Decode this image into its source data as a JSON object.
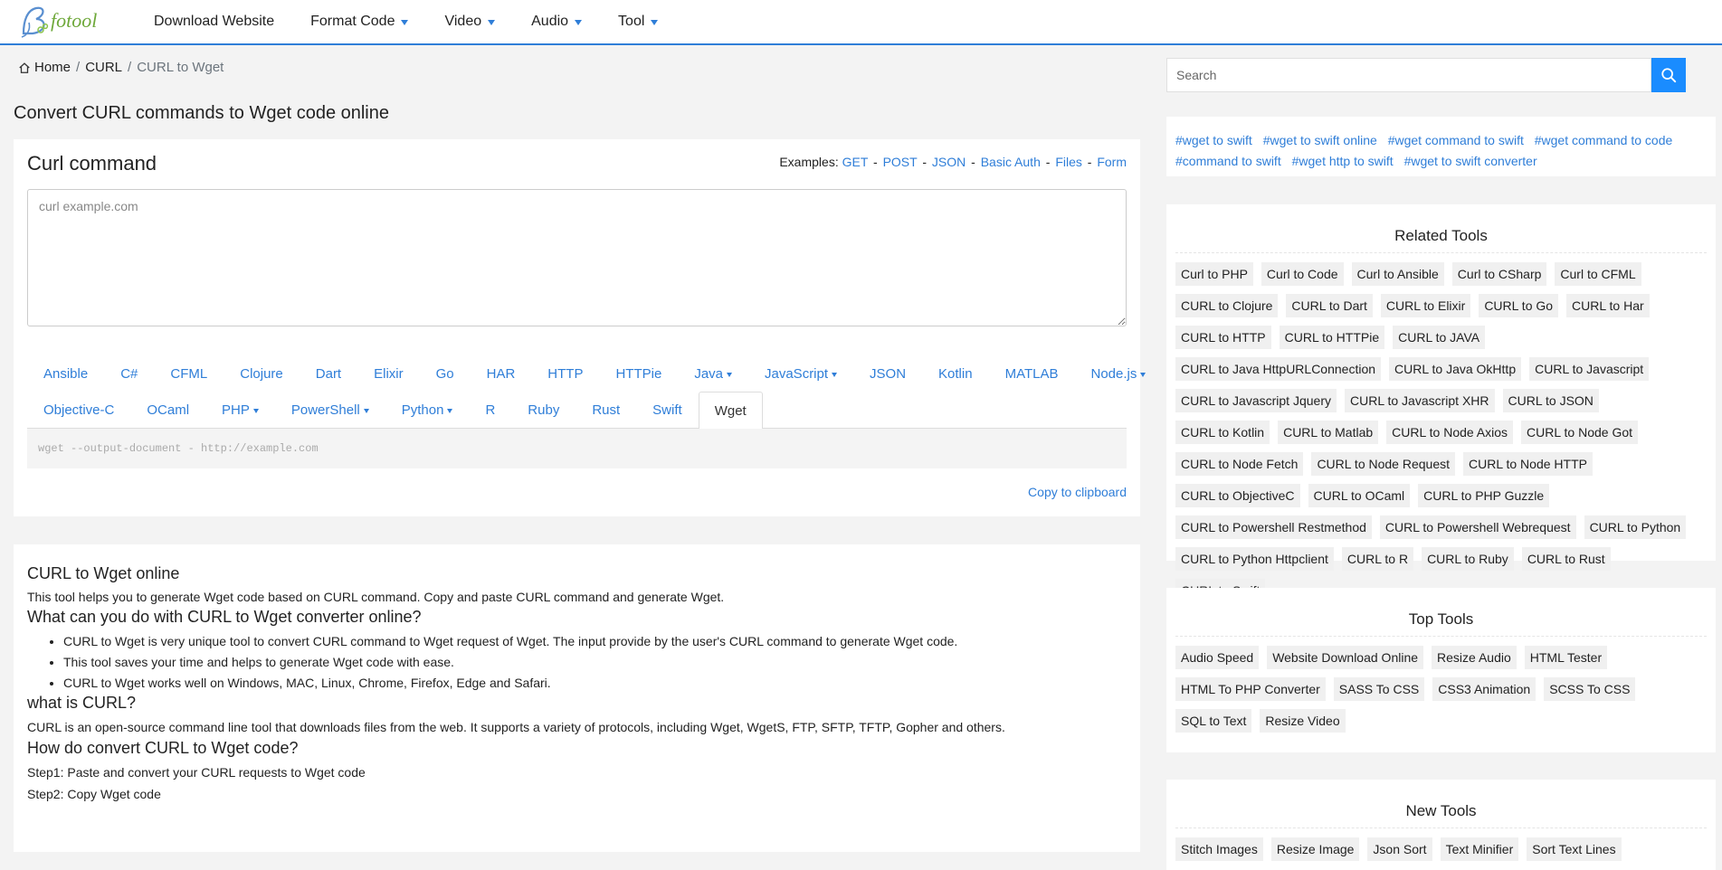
{
  "nav": {
    "logo_text": "fotool",
    "items": [
      {
        "label": "Download Website",
        "dropdown": false
      },
      {
        "label": "Format Code",
        "dropdown": true
      },
      {
        "label": "Video",
        "dropdown": true
      },
      {
        "label": "Audio",
        "dropdown": true
      },
      {
        "label": "Tool",
        "dropdown": true
      }
    ]
  },
  "breadcrumb": {
    "home": "Home",
    "sep1": "/",
    "curl": "CURL",
    "sep2": "/",
    "current": "CURL to Wget"
  },
  "page_title": "Convert CURL commands to Wget code online",
  "tool": {
    "title": "Curl command",
    "examples_label": "Examples:",
    "examples": [
      "GET",
      "POST",
      "JSON",
      "Basic Auth",
      "Files",
      "Form"
    ],
    "input_placeholder": "curl example.com",
    "tabs_row1": [
      {
        "label": "Ansible",
        "dropdown": false
      },
      {
        "label": "C#",
        "dropdown": false
      },
      {
        "label": "CFML",
        "dropdown": false
      },
      {
        "label": "Clojure",
        "dropdown": false
      },
      {
        "label": "Dart",
        "dropdown": false
      },
      {
        "label": "Elixir",
        "dropdown": false
      },
      {
        "label": "Go",
        "dropdown": false
      },
      {
        "label": "HAR",
        "dropdown": false
      },
      {
        "label": "HTTP",
        "dropdown": false
      },
      {
        "label": "HTTPie",
        "dropdown": false
      },
      {
        "label": "Java",
        "dropdown": true
      },
      {
        "label": "JavaScript",
        "dropdown": true
      },
      {
        "label": "JSON",
        "dropdown": false
      },
      {
        "label": "Kotlin",
        "dropdown": false
      },
      {
        "label": "MATLAB",
        "dropdown": false
      },
      {
        "label": "Node.js",
        "dropdown": true
      }
    ],
    "tabs_row2": [
      {
        "label": "Objective-C",
        "dropdown": false
      },
      {
        "label": "OCaml",
        "dropdown": false
      },
      {
        "label": "PHP",
        "dropdown": true
      },
      {
        "label": "PowerShell",
        "dropdown": true
      },
      {
        "label": "Python",
        "dropdown": true
      },
      {
        "label": "R",
        "dropdown": false
      },
      {
        "label": "Ruby",
        "dropdown": false
      },
      {
        "label": "Rust",
        "dropdown": false
      },
      {
        "label": "Swift",
        "dropdown": false
      },
      {
        "label": "Wget",
        "dropdown": false,
        "active": true
      }
    ],
    "output": "wget --output-document - http://example.com",
    "copy_label": "Copy to clipboard"
  },
  "info": {
    "h1": "CURL to Wget online",
    "p1": "This tool helps you to generate Wget code based on CURL command. Copy and paste CURL command and generate Wget.",
    "h2": "What can you do with CURL to Wget converter online?",
    "bullets": [
      "CURL to Wget is very unique tool to convert CURL command to Wget request of Wget. The input provide by the user's CURL command to generate Wget code.",
      "This tool saves your time and helps to generate Wget code with ease.",
      "CURL to Wget works well on Windows, MAC, Linux, Chrome, Firefox, Edge and Safari."
    ],
    "h3": "what is CURL?",
    "p2": "CURL is an open-source command line tool that downloads files from the web. It supports a variety of protocols, including Wget, WgetS, FTP, SFTP, TFTP, Gopher and others.",
    "h4": "How do convert CURL to Wget code?",
    "step1": "Step1: Paste and convert your CURL requests to Wget code",
    "step2": "Step2: Copy Wget code"
  },
  "sidebar": {
    "search_placeholder": "Search",
    "tags": [
      "#wget to swift",
      "#wget to swift online",
      "#wget command to swift",
      "#wget command to code",
      "#command to swift",
      "#wget http to swift",
      "#wget to swift converter"
    ],
    "related_title": "Related Tools",
    "related": [
      "Curl to PHP",
      "Curl to Code",
      "Curl to Ansible",
      "Curl to CSharp",
      "Curl to CFML",
      "CURL to Clojure",
      "CURL to Dart",
      "CURL to Elixir",
      "CURL to Go",
      "CURL to Har",
      "CURL to HTTP",
      "CURL to HTTPie",
      "CURL to JAVA",
      "CURL to Java HttpURLConnection",
      "CURL to Java OkHttp",
      "CURL to Javascript",
      "CURL to Javascript Jquery",
      "CURL to Javascript XHR",
      "CURL to JSON",
      "CURL to Kotlin",
      "CURL to Matlab",
      "CURL to Node Axios",
      "CURL to Node Got",
      "CURL to Node Fetch",
      "CURL to Node Request",
      "CURL to Node HTTP",
      "CURL to ObjectiveC",
      "CURL to OCaml",
      "CURL to PHP Guzzle",
      "CURL to Powershell Restmethod",
      "CURL to Powershell Webrequest",
      "CURL to Python",
      "CURL to Python Httpclient",
      "CURL to R",
      "CURL to Ruby",
      "CURL to Rust",
      "CURL to Swift"
    ],
    "top_title": "Top Tools",
    "top": [
      "Audio Speed",
      "Website Download Online",
      "Resize Audio",
      "HTML Tester",
      "HTML To PHP Converter",
      "SASS To CSS",
      "CSS3 Animation",
      "SCSS To CSS",
      "SQL to Text",
      "Resize Video"
    ],
    "new_title": "New Tools",
    "new": [
      "Stitch Images",
      "Resize Image",
      "Json Sort",
      "Text Minifier",
      "Sort Text Lines"
    ]
  },
  "colors": {
    "accent": "#2f7ed8",
    "search_button": "#1a8cff",
    "page_bg": "#f3f3f3"
  }
}
